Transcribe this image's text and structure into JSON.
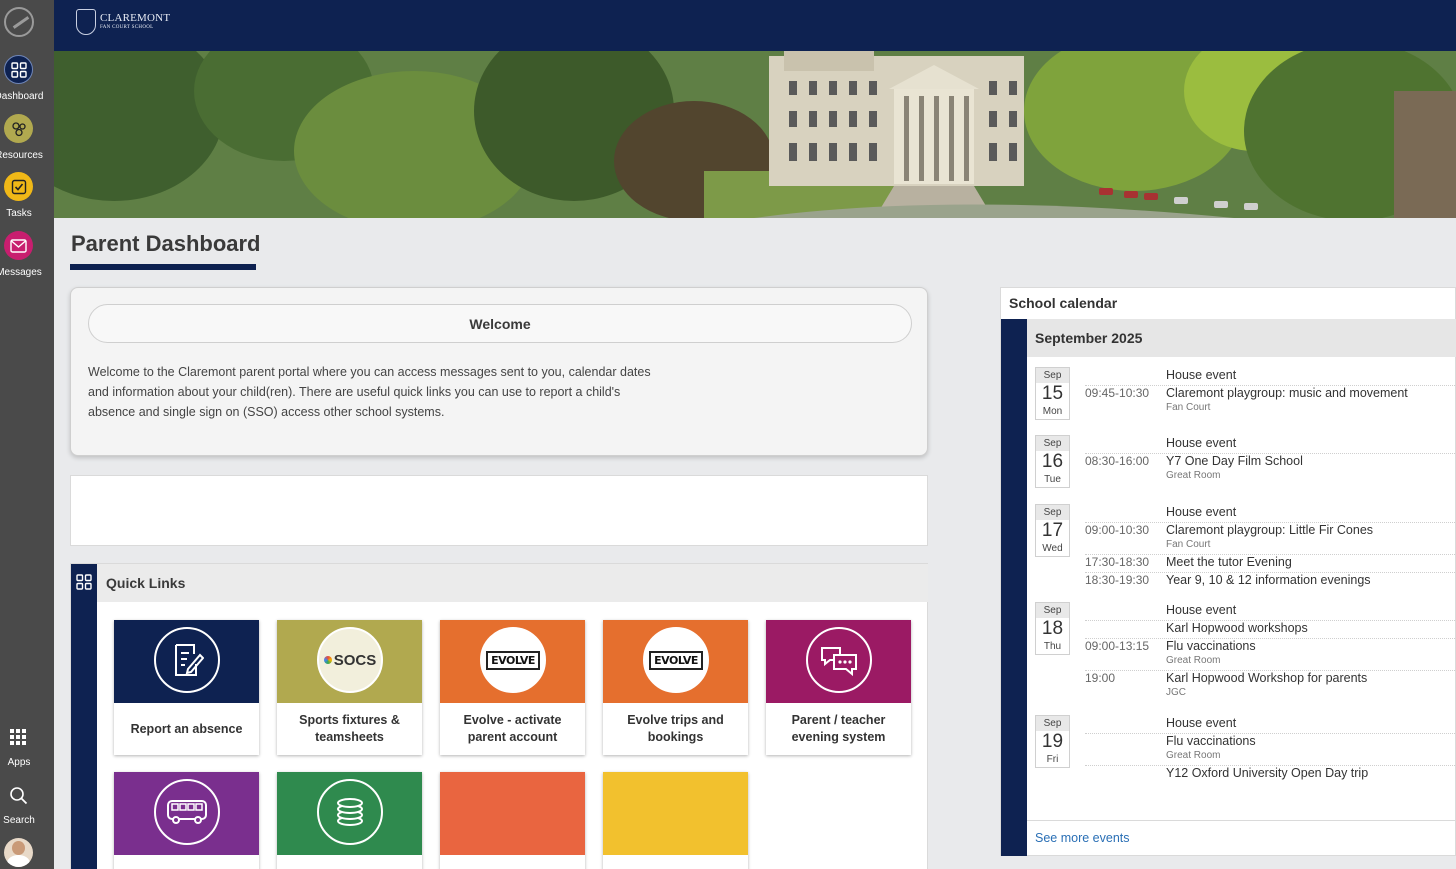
{
  "sidebar": {
    "items": [
      {
        "label": "Dashboard",
        "icon": "dashboard-grid-icon",
        "color": "#0e2251"
      },
      {
        "label": "Resources",
        "icon": "resources-icon",
        "color": "#b1a94f"
      },
      {
        "label": "Tasks",
        "icon": "tasks-checkbox-icon",
        "color": "#f0b817"
      },
      {
        "label": "Messages",
        "icon": "envelope-icon",
        "color": "#c81e6f"
      }
    ],
    "bottom": [
      {
        "label": "Apps",
        "icon": "apps-grid-icon"
      },
      {
        "label": "Search",
        "icon": "search-icon"
      }
    ]
  },
  "header": {
    "brand_name": "CLAREMONT",
    "brand_sub": "FAN COURT SCHOOL"
  },
  "page": {
    "title": "Parent Dashboard"
  },
  "welcome": {
    "heading": "Welcome",
    "body": "Welcome to the Claremont parent portal where you can access messages sent to you, calendar dates and information about your child(ren). There are useful quick links you can use to report a child's absence and single sign on (SSO) access other school systems."
  },
  "quick_links": {
    "title": "Quick Links",
    "tiles": [
      {
        "label": "Report an absence",
        "color": "#0e2251",
        "icon": "report-form-icon"
      },
      {
        "label": "Sports fixtures & teamsheets",
        "color": "#b1a94f",
        "icon": "socs-logo-icon",
        "badge": "SOCS"
      },
      {
        "label": "Evolve - activate parent account",
        "color": "#e56f2e",
        "icon": "evolve-logo-icon",
        "badge": "EVOLVE"
      },
      {
        "label": "Evolve trips and bookings",
        "color": "#e56f2e",
        "icon": "evolve-logo-icon",
        "badge": "EVOLVE"
      },
      {
        "label": "Parent / teacher evening system",
        "color": "#9b1a64",
        "icon": "chat-bubbles-icon"
      },
      {
        "label": "",
        "color": "#7a2f8e",
        "icon": "bus-icon"
      },
      {
        "label": "",
        "color": "#2f8a4e",
        "icon": "coins-icon"
      },
      {
        "label": "",
        "color": "#e96540",
        "icon": ""
      },
      {
        "label": "",
        "color": "#f2c12e",
        "icon": ""
      }
    ]
  },
  "calendar": {
    "title": "School calendar",
    "month": "September 2025",
    "days": [
      {
        "mon": "Sep",
        "num": "15",
        "dow": "Mon",
        "events": [
          {
            "time": "",
            "title": "House event",
            "loc": ""
          },
          {
            "time": "09:45-10:30",
            "title": "Claremont playgroup: music and movement",
            "loc": "Fan Court"
          }
        ]
      },
      {
        "mon": "Sep",
        "num": "16",
        "dow": "Tue",
        "events": [
          {
            "time": "",
            "title": "House event",
            "loc": ""
          },
          {
            "time": "08:30-16:00",
            "title": "Y7 One Day Film School",
            "loc": "Great Room"
          }
        ]
      },
      {
        "mon": "Sep",
        "num": "17",
        "dow": "Wed",
        "events": [
          {
            "time": "",
            "title": "House event",
            "loc": ""
          },
          {
            "time": "09:00-10:30",
            "title": "Claremont playgroup: Little Fir Cones",
            "loc": "Fan Court"
          },
          {
            "time": "17:30-18:30",
            "title": "Meet the tutor Evening",
            "loc": ""
          },
          {
            "time": "18:30-19:30",
            "title": "Year 9, 10 & 12 information evenings",
            "loc": ""
          }
        ]
      },
      {
        "mon": "Sep",
        "num": "18",
        "dow": "Thu",
        "events": [
          {
            "time": "",
            "title": "House event",
            "loc": ""
          },
          {
            "time": "",
            "title": "Karl Hopwood workshops",
            "loc": ""
          },
          {
            "time": "09:00-13:15",
            "title": "Flu vaccinations",
            "loc": "Great Room"
          },
          {
            "time": "19:00",
            "title": "Karl Hopwood Workshop for parents",
            "loc": "JGC"
          }
        ]
      },
      {
        "mon": "Sep",
        "num": "19",
        "dow": "Fri",
        "events": [
          {
            "time": "",
            "title": "House event",
            "loc": ""
          },
          {
            "time": "",
            "title": "Flu vaccinations",
            "loc": "Great Room"
          },
          {
            "time": "",
            "title": "Y12 Oxford University Open Day trip",
            "loc": ""
          }
        ]
      }
    ],
    "see_more": "See more events"
  }
}
